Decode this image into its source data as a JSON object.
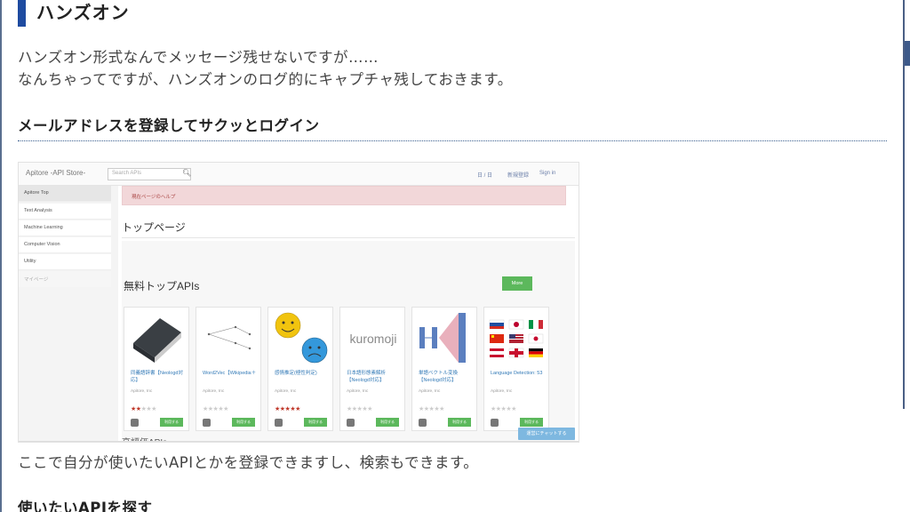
{
  "section": {
    "heading": "ハンズオン",
    "para1": "ハンズオン形式なんでメッセージ残せないですが……",
    "para2": "なんちゃってですが、ハンズオンのログ的にキャプチャ残しておきます。",
    "subheading": "メールアドレスを登録してサクッとログイン",
    "para3": "ここで自分が使いたいAPIとかを登録できますし、検索もできます。",
    "subheading2": "使いたいAPIを探す"
  },
  "screenshot": {
    "brand": "Apitore -API Store-",
    "search_placeholder": "Search APIs",
    "nav": [
      "日 / 日",
      "新規登録",
      "Sign in"
    ],
    "sidebar": [
      "Apitore Top",
      "Text Analysis",
      "Machine Learning",
      "Computer Vision",
      "Utility",
      "マイページ"
    ],
    "alert": "現在ページのヘルプ",
    "page_title": "トップページ",
    "apis_title": "無料トップAPIs",
    "more_label": "More",
    "cards": [
      {
        "name": "同義語辞書【Neologd対応】",
        "vendor": "Apitore, Inc",
        "stars": 2,
        "btn": "利用する"
      },
      {
        "name": "Word2Vec【Wikipedia＋",
        "vendor": "Apitore, Inc",
        "stars": 0,
        "btn": "利用する"
      },
      {
        "name": "感情推定(極性判定)",
        "vendor": "Apitore, Inc",
        "stars": 5,
        "btn": "利用する"
      },
      {
        "name": "日本語形態素解析【Neologd対応】",
        "vendor": "Apitore, Inc",
        "stars": 0,
        "btn": "利用する"
      },
      {
        "name": "単語ベクトル変換【Neologd対応】",
        "vendor": "Apitore, Inc",
        "stars": 0,
        "btn": "利用する"
      },
      {
        "name": "Language Detection: 53",
        "vendor": "Apitore, Inc",
        "stars": 0,
        "btn": "利用する"
      }
    ],
    "kuromoji": "kuromoji",
    "cta": "運営にチャットする",
    "next_section": "高評価APIs"
  }
}
